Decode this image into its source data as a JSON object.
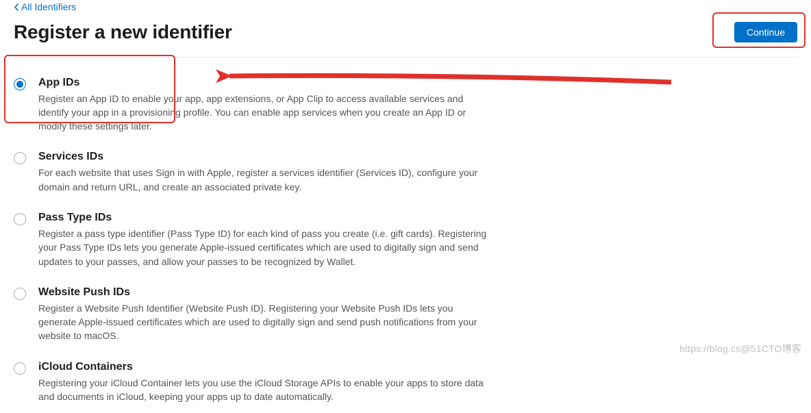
{
  "nav": {
    "back_label": "All Identifiers"
  },
  "header": {
    "title": "Register a new identifier",
    "continue_label": "Continue"
  },
  "options": [
    {
      "title": "App IDs",
      "selected": true,
      "desc": "Register an App ID to enable your app, app extensions, or App Clip to access available services and identify your app in a provisioning profile. You can enable app services when you create an App ID or modify these settings later."
    },
    {
      "title": "Services IDs",
      "selected": false,
      "desc": "For each website that uses Sign in with Apple, register a services identifier (Services ID), configure your domain and return URL, and create an associated private key."
    },
    {
      "title": "Pass Type IDs",
      "selected": false,
      "desc": "Register a pass type identifier (Pass Type ID) for each kind of pass you create (i.e. gift cards). Registering your Pass Type IDs lets you generate Apple-issued certificates which are used to digitally sign and send updates to your passes, and allow your passes to be recognized by Wallet."
    },
    {
      "title": "Website Push IDs",
      "selected": false,
      "desc": "Register a Website Push Identifier (Website Push ID). Registering your Website Push IDs lets you generate Apple-issued certificates which are used to digitally sign and send push notifications from your website to macOS."
    },
    {
      "title": "iCloud Containers",
      "selected": false,
      "desc": "Registering your iCloud Container lets you use the iCloud Storage APIs to enable your apps to store data and documents in iCloud, keeping your apps up to date automatically."
    }
  ],
  "watermark": "https://blog.cs@51CTO博客"
}
